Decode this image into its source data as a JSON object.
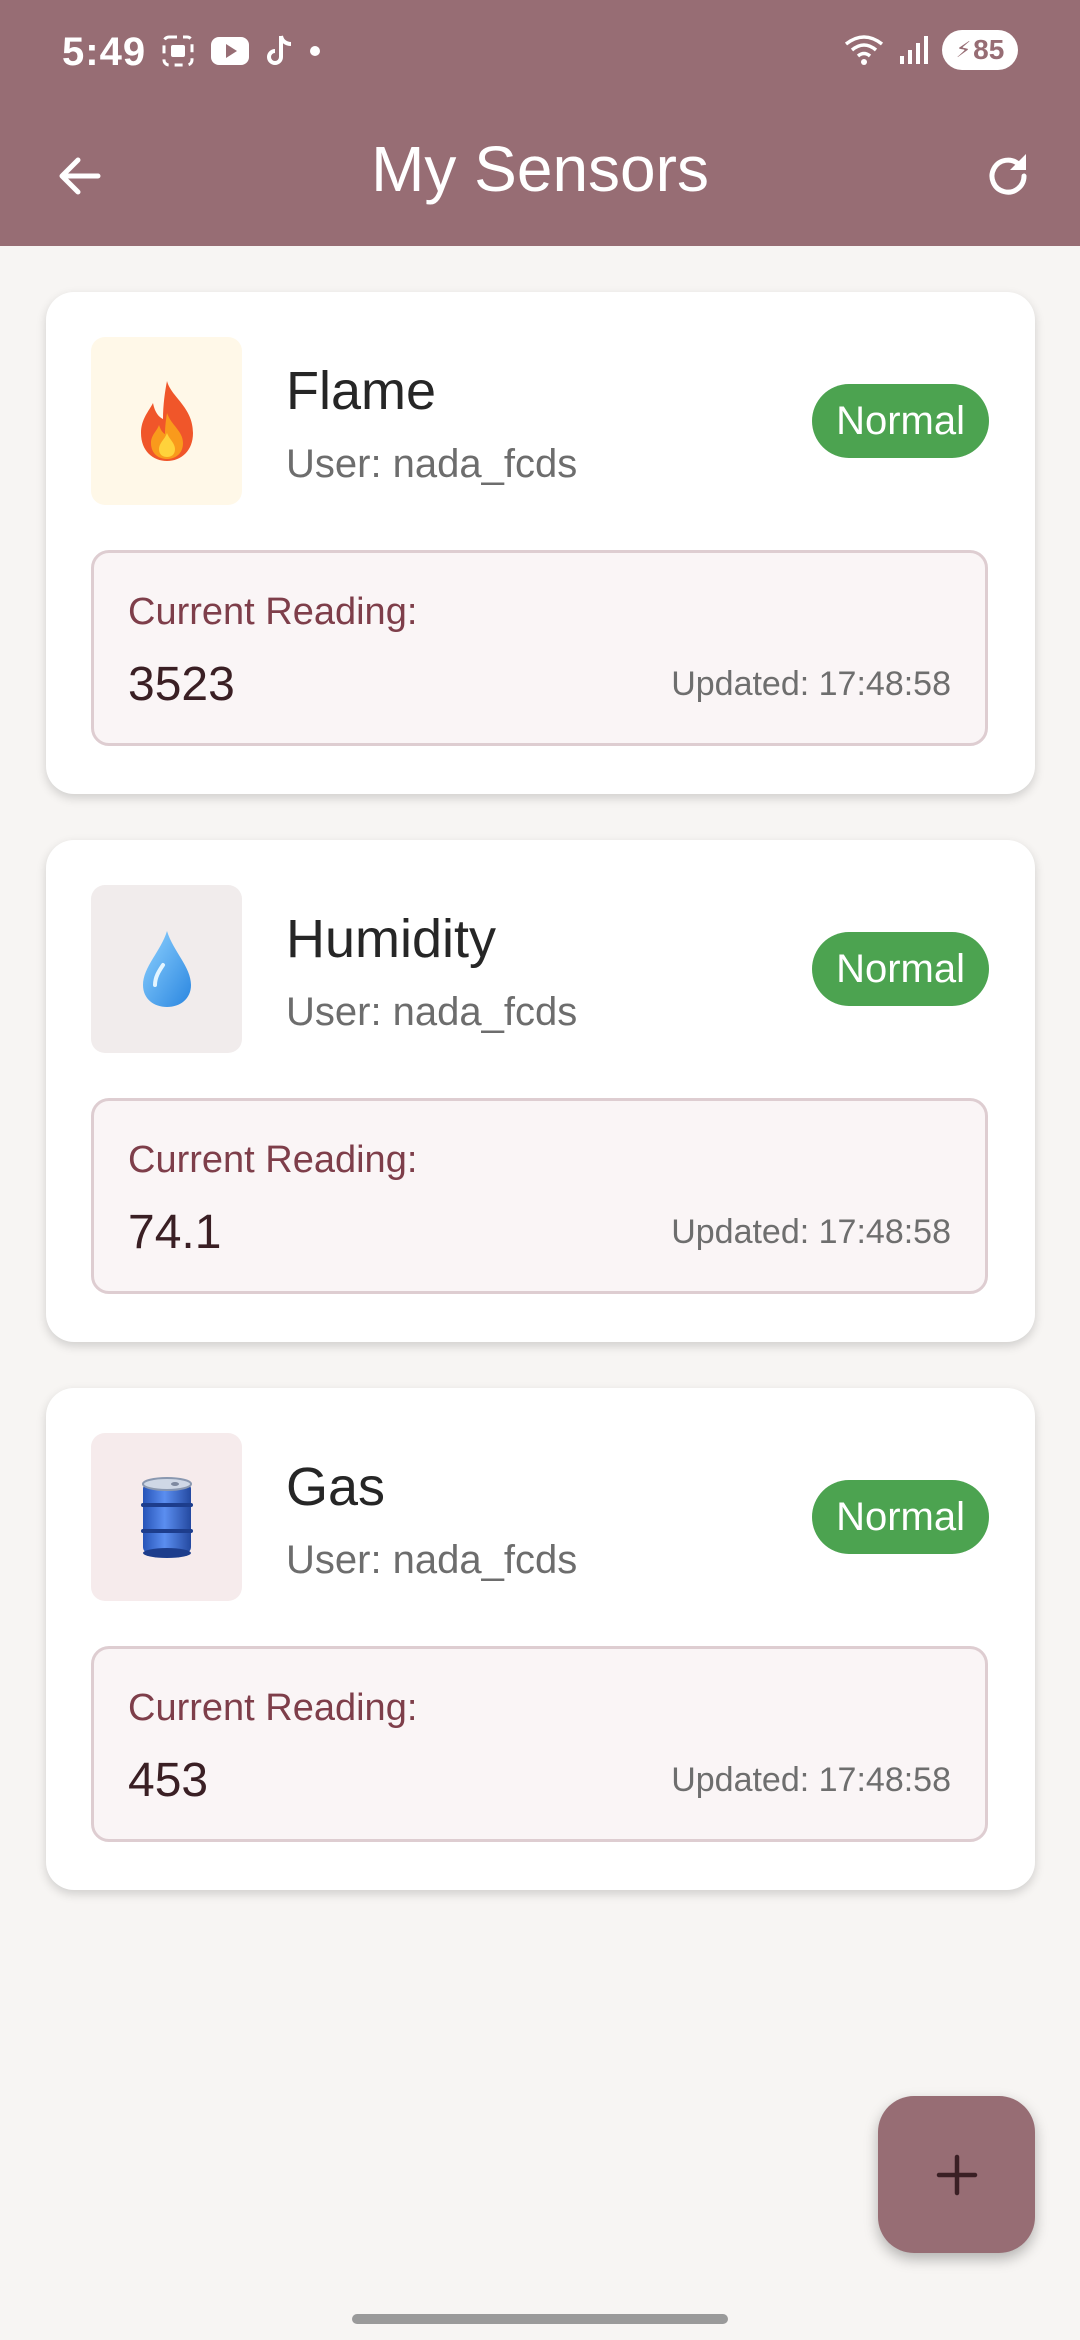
{
  "status_bar": {
    "time": "5:49",
    "battery": "85"
  },
  "app_bar": {
    "title": "My Sensors"
  },
  "sensors": [
    {
      "name": "Flame",
      "user": "User: nada_fcds",
      "status": "Normal",
      "reading_label": "Current Reading:",
      "reading_value": "3523",
      "updated": "Updated: 17:48:58",
      "icon": "flame-icon",
      "icon_bg": "#fff8e8"
    },
    {
      "name": "Humidity",
      "user": "User: nada_fcds",
      "status": "Normal",
      "reading_label": "Current Reading:",
      "reading_value": "74.1",
      "updated": "Updated: 17:48:58",
      "icon": "water-drop-icon",
      "icon_bg": "#f1ecec"
    },
    {
      "name": "Gas",
      "user": "User: nada_fcds",
      "status": "Normal",
      "reading_label": "Current Reading:",
      "reading_value": "453",
      "updated": "Updated: 17:48:58",
      "icon": "gas-barrel-icon",
      "icon_bg": "#f6ebec"
    }
  ],
  "colors": {
    "primary": "#976d74",
    "status_normal": "#4ca350",
    "reading_label": "#7e3e4a",
    "background": "#f7f5f3"
  }
}
